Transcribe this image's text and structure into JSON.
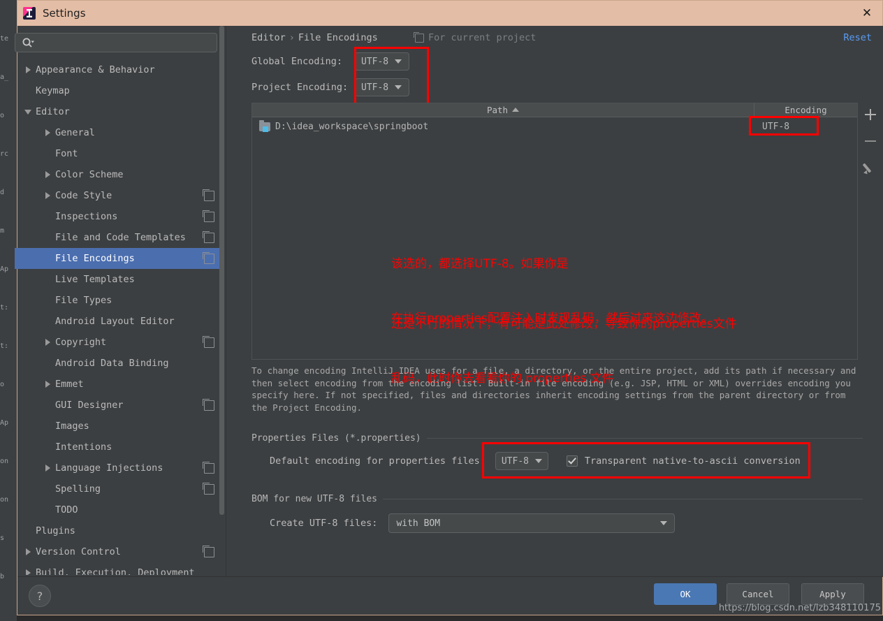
{
  "window": {
    "title": "Settings",
    "app_icon": "intellij-idea-icon",
    "close_label": "✕"
  },
  "background_ide_lines": [
    "te",
    "a_",
    "o",
    "rc",
    "d",
    "m",
    "Ap",
    "t:",
    "t:",
    "o",
    "Ap",
    "on",
    "on",
    "s",
    "b"
  ],
  "sidebar": {
    "search": {
      "placeholder": "",
      "value": "",
      "icon": "search-icon"
    },
    "items": [
      {
        "label": "Appearance & Behavior",
        "indent": 0,
        "arrow": "right",
        "copy": false,
        "selected": false
      },
      {
        "label": "Keymap",
        "indent": 0,
        "arrow": "none",
        "copy": false,
        "selected": false
      },
      {
        "label": "Editor",
        "indent": 0,
        "arrow": "down",
        "copy": false,
        "selected": false
      },
      {
        "label": "General",
        "indent": 1,
        "arrow": "right",
        "copy": false,
        "selected": false
      },
      {
        "label": "Font",
        "indent": 1,
        "arrow": "none",
        "copy": false,
        "selected": false
      },
      {
        "label": "Color Scheme",
        "indent": 1,
        "arrow": "right",
        "copy": false,
        "selected": false
      },
      {
        "label": "Code Style",
        "indent": 1,
        "arrow": "right",
        "copy": true,
        "selected": false
      },
      {
        "label": "Inspections",
        "indent": 1,
        "arrow": "none",
        "copy": true,
        "selected": false
      },
      {
        "label": "File and Code Templates",
        "indent": 1,
        "arrow": "none",
        "copy": true,
        "selected": false
      },
      {
        "label": "File Encodings",
        "indent": 1,
        "arrow": "none",
        "copy": true,
        "selected": true
      },
      {
        "label": "Live Templates",
        "indent": 1,
        "arrow": "none",
        "copy": false,
        "selected": false
      },
      {
        "label": "File Types",
        "indent": 1,
        "arrow": "none",
        "copy": false,
        "selected": false
      },
      {
        "label": "Android Layout Editor",
        "indent": 1,
        "arrow": "none",
        "copy": false,
        "selected": false
      },
      {
        "label": "Copyright",
        "indent": 1,
        "arrow": "right",
        "copy": true,
        "selected": false
      },
      {
        "label": "Android Data Binding",
        "indent": 1,
        "arrow": "none",
        "copy": false,
        "selected": false
      },
      {
        "label": "Emmet",
        "indent": 1,
        "arrow": "right",
        "copy": false,
        "selected": false
      },
      {
        "label": "GUI Designer",
        "indent": 1,
        "arrow": "none",
        "copy": true,
        "selected": false
      },
      {
        "label": "Images",
        "indent": 1,
        "arrow": "none",
        "copy": false,
        "selected": false
      },
      {
        "label": "Intentions",
        "indent": 1,
        "arrow": "none",
        "copy": false,
        "selected": false
      },
      {
        "label": "Language Injections",
        "indent": 1,
        "arrow": "right",
        "copy": true,
        "selected": false
      },
      {
        "label": "Spelling",
        "indent": 1,
        "arrow": "none",
        "copy": true,
        "selected": false
      },
      {
        "label": "TODO",
        "indent": 1,
        "arrow": "none",
        "copy": false,
        "selected": false
      },
      {
        "label": "Plugins",
        "indent": 0,
        "arrow": "none",
        "copy": false,
        "selected": false
      },
      {
        "label": "Version Control",
        "indent": 0,
        "arrow": "right",
        "copy": true,
        "selected": false
      },
      {
        "label": "Build, Execution, Deployment",
        "indent": 0,
        "arrow": "right",
        "copy": false,
        "selected": false
      }
    ]
  },
  "main": {
    "breadcrumb": {
      "root": "Editor",
      "separator": "›",
      "leaf": "File Encodings"
    },
    "for_current_project": "For current project",
    "reset_link": "Reset",
    "global_encoding": {
      "label": "Global Encoding:",
      "value": "UTF-8"
    },
    "project_encoding": {
      "label": "Project Encoding:",
      "value": "UTF-8"
    },
    "table": {
      "columns": [
        "Path",
        "Encoding"
      ],
      "sorted_column": "Path",
      "sort_direction": "ascending",
      "rows": [
        {
          "path": "D:\\idea_workspace\\springboot",
          "encoding": "UTF-8"
        }
      ],
      "toolbar": [
        "add-icon",
        "remove-icon",
        "edit-icon"
      ]
    },
    "help_text": "To change encoding IntelliJ IDEA uses for a file, a directory, or the entire project, add its path if necessary and then select encoding from the encoding list. Built-in file encoding (e.g. JSP, HTML or XML) overrides encoding you specify here. If not specified, files and directories inherit encoding settings from the parent directory or from the Project Encoding.",
    "properties_group": {
      "title": "Properties Files (*.properties)",
      "default_encoding_label": "Default encoding for properties files:",
      "default_encoding_value": "UTF-8",
      "transparent_label": "Transparent native-to-ascii conversion",
      "transparent_checked": true
    },
    "bom_group": {
      "title": "BOM for new UTF-8 files",
      "create_label": "Create UTF-8 files:",
      "create_value": "with BOM"
    }
  },
  "annotations": {
    "color": "#ff0000",
    "block1_line1": "该选的，都选择UTF-8。如果你是",
    "block1_line2": "在执行properties配置注入时发现乱码，然后过来这边修改。",
    "block2_line1": "还是不行的情况下，有可能是此处修改，导致你的properties文件",
    "block2_line2": "乱码，此时你去看看你的 properties 文件"
  },
  "footer": {
    "help": "?",
    "ok": "OK",
    "cancel": "Cancel",
    "apply": "Apply",
    "watermark": "https://blog.csdn.net/lzb348110175"
  }
}
